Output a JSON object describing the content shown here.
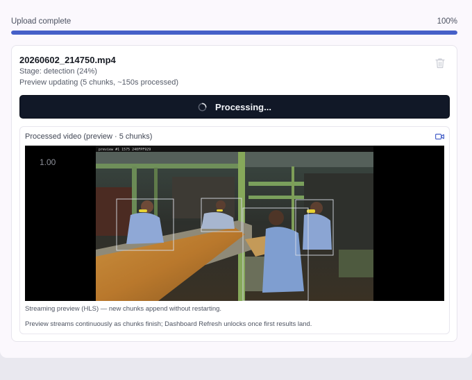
{
  "upload": {
    "status_label": "Upload complete",
    "percent_label": "100%",
    "progress_fraction": 1.0,
    "accent_color": "#4660c8"
  },
  "job": {
    "file_name": "20260602_214750.mp4",
    "stage": "Stage: detection (24%)",
    "preview_status": "Preview updating (5 chunks, ~150s processed)",
    "delete_icon": "trash-icon",
    "process_button_label": "Processing...",
    "process_button_icon": "spinner-icon"
  },
  "video": {
    "panel_title": "Processed video (preview · 5 chunks)",
    "panel_icon": "video-camera-icon",
    "playback_rate": "1.00",
    "overlay_text": "preview #1   1575   240FPF929",
    "caption_streaming": "Streaming preview (HLS) — new chunks append without restarting.",
    "caption_note": "Preview streams continuously as chunks finish; Dashboard Refresh unlocks once first results land."
  }
}
